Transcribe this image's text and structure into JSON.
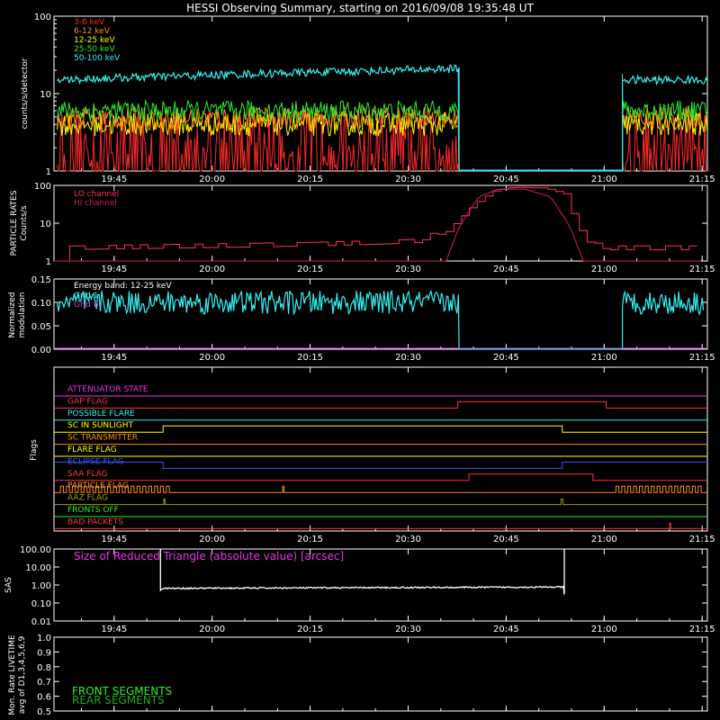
{
  "title": "HESSI Observing Summary, starting on 2016/09/08 19:35:48 UT",
  "colors": {
    "bg": "#000000",
    "axis": "#ffffff",
    "e3_6": "#ff2a2a",
    "e6_12": "#ff8c1a",
    "e12_25": "#ffff00",
    "e25_50": "#2aee2a",
    "e50_100": "#33f0f0",
    "lo": "#ff3355",
    "hi": "#cc2255",
    "modulation": "#33f0f0",
    "sas": "#ffffff",
    "magenta": "#ee33ee"
  },
  "x_time_labels": [
    "19:45",
    "20:00",
    "20:15",
    "20:30",
    "20:45",
    "21:00",
    "21:15"
  ],
  "x_minutes": [
    9.2,
    24.2,
    39.2,
    54.2,
    69.2,
    84.2,
    99.2
  ],
  "panels": {
    "counts": {
      "ylabel": "counts/s/detector",
      "yticks": [
        "1",
        "10",
        "100"
      ],
      "legend": [
        "3-6 keV",
        "6-12 keV",
        "12-25 keV",
        "25-50 keV",
        "50-100 keV"
      ]
    },
    "particle": {
      "ylabel_1": "PARTICLE RATES",
      "ylabel_2": "Counts/s",
      "yticks": [
        "1",
        "10",
        "100"
      ],
      "legend": [
        "LO channel",
        "HI channel"
      ]
    },
    "modulation": {
      "ylabel_1": "Normalized",
      "ylabel_2": "modulation",
      "yticks": [
        "0.00",
        "0.05",
        "0.10",
        "0.15"
      ],
      "energy_band": "Energy band: 12-25 keV",
      "legend": [
        "Grid 1",
        "Grid 8"
      ]
    },
    "flags": {
      "ylabel": "Flags",
      "names": [
        "ATTENUATOR STATE",
        "GAP FLAG",
        "POSSIBLE FLARE",
        "SC IN SUNLIGHT",
        "SC TRANSMITTER",
        "FLARE FLAG",
        "ECLIPSE FLAG",
        "SAA FLAG",
        "PARTICLE FLAG",
        "AAZ FLAG",
        "FRONTS OFF",
        "BAD PACKETS"
      ],
      "label_colors": [
        "#ee33ee",
        "#ff3344",
        "#33f0f0",
        "#ffff00",
        "#ff8c1a",
        "#ffff00",
        "#3355ff",
        "#ff3344",
        "#ff8c1a",
        "#a0a000",
        "#2aee2a",
        "#ff3344"
      ]
    },
    "sas": {
      "ylabel": "SAS",
      "yticks": [
        "0.01",
        "0.10",
        "1.00",
        "10.00",
        "100.00"
      ],
      "annotation": "Size of Reduced Triangle (absolute value) [arcsec]"
    },
    "livetime": {
      "ylabel_1": "Mon. Rate LIVETIME",
      "ylabel_2": "avg of D1,3,4,5,6,9",
      "yticks": [
        "0.5",
        "0.6",
        "0.7",
        "0.8",
        "0.9",
        "1.0"
      ],
      "legend": [
        "FRONT SEGMENTS",
        "REAR SEGMENTS"
      ],
      "legend_colors": [
        "#2aee2a",
        "#22aa22"
      ]
    }
  },
  "chart_data": [
    {
      "type": "line",
      "title": "HESSI Observing Summary, starting on 2016/09/08 19:35:48 UT",
      "ylabel": "counts/s/detector",
      "ylog": true,
      "ylim": [
        1,
        100
      ],
      "xlim_minutes": [
        0,
        100
      ],
      "x_unit": "minutes after 19:35:48",
      "data_gap_minutes": [
        62.0,
        87.0
      ],
      "series": [
        {
          "name": "3-6 keV",
          "level": 2.5
        },
        {
          "name": "6-12 keV",
          "level": 4.8
        },
        {
          "name": "12-25 keV",
          "level": 4.0
        },
        {
          "name": "25-50 keV",
          "level": 6.0
        },
        {
          "name": "50-100 keV",
          "level": 15
        }
      ]
    },
    {
      "type": "line",
      "ylabel": "Counts/s",
      "ylog": true,
      "ylim": [
        1,
        100
      ],
      "series": [
        {
          "name": "LO channel",
          "x": [
            0,
            1.5,
            1.5,
            40,
            55,
            60,
            64,
            67,
            70,
            75,
            78,
            80,
            82,
            85,
            99
          ],
          "y": [
            1,
            1,
            2.0,
            2.5,
            3.0,
            6,
            30,
            70,
            90,
            85,
            60,
            8,
            2.5,
            2.0,
            2.0
          ]
        },
        {
          "name": "HI channel",
          "x": [
            0,
            60,
            62,
            65,
            68,
            72,
            76,
            79,
            81,
            99
          ],
          "y": [
            1,
            1,
            8,
            50,
            80,
            80,
            50,
            8,
            1,
            1
          ]
        }
      ]
    },
    {
      "type": "line",
      "ylabel": "Normalized modulation",
      "ylim": [
        0.0,
        0.15
      ],
      "series": [
        {
          "name": "Grid 1",
          "level": 0.1
        },
        {
          "name": "Grid 8",
          "level": 0.1
        }
      ]
    },
    {
      "type": "line",
      "ylabel": "SAS",
      "ylog": true,
      "ylim": [
        0.01,
        100
      ],
      "series": [
        {
          "name": "Size of Reduced Triangle",
          "x": [
            16.3,
            16.6,
            18,
            30,
            50,
            78,
            78.2
          ],
          "y": [
            100,
            0.7,
            0.65,
            0.7,
            0.75,
            0.8,
            100
          ]
        }
      ]
    }
  ]
}
